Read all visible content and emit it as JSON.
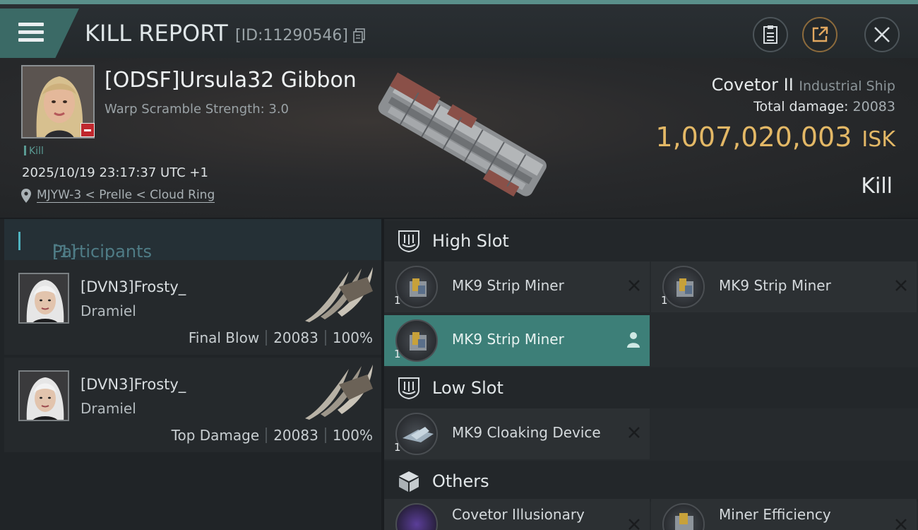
{
  "header": {
    "title": "KILL REPORT",
    "report_id": "[ID:11290546]"
  },
  "victim": {
    "name": "[ODSF]Ursula32 Gibbon",
    "scramble": "Warp Scramble Strength: 3.0",
    "kill_tag": "Kill",
    "datetime": "2025/10/19 23:17:37 UTC +1",
    "location": "MJYW-3 < Prelle < Cloud Ring"
  },
  "ship": {
    "name": "Covetor II",
    "type": "Industrial Ship",
    "total_damage_label": "Total damage:",
    "total_damage": "20083",
    "isk_value": "1,007,020,003",
    "isk_unit": "ISK",
    "result": "Kill"
  },
  "participants": {
    "label": "Participants",
    "count": "[1]",
    "items": [
      {
        "name": "[DVN3]Frosty_",
        "ship": "Dramiel",
        "role": "Final Blow",
        "damage": "20083",
        "percent": "100%"
      },
      {
        "name": "[DVN3]Frosty_",
        "ship": "Dramiel",
        "role": "Top Damage",
        "damage": "20083",
        "percent": "100%"
      }
    ]
  },
  "fittings": {
    "high_slot": {
      "label": "High Slot",
      "modules": [
        {
          "name": "MK9 Strip Miner",
          "qty": "1",
          "state": "destroyed"
        },
        {
          "name": "MK9 Strip Miner",
          "qty": "1",
          "state": "destroyed"
        },
        {
          "name": "MK9 Strip Miner",
          "qty": "1",
          "state": "dropped"
        }
      ]
    },
    "low_slot": {
      "label": "Low Slot",
      "modules": [
        {
          "name": "MK9 Cloaking Device",
          "qty": "1",
          "state": "destroyed"
        }
      ]
    },
    "others": {
      "label": "Others",
      "modules": [
        {
          "name": "Covetor Illusionary",
          "qty": "",
          "state": "destroyed"
        },
        {
          "name": "Miner Efficiency",
          "qty": "",
          "state": "destroyed"
        }
      ]
    }
  },
  "colors": {
    "accent": "#3d7f78",
    "isk": "#e3b866",
    "badge": "#c0272d"
  }
}
